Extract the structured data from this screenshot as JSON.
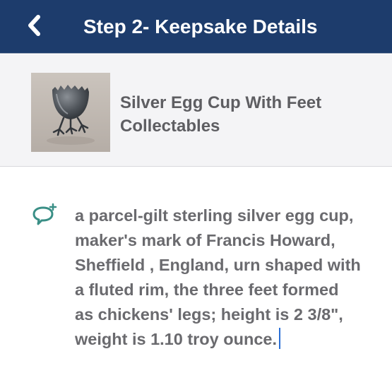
{
  "header": {
    "title": "Step 2- Keepsake Details",
    "back_icon": "chevron-left-icon"
  },
  "item": {
    "name": "Silver Egg Cup With Feet",
    "category": "Collectables"
  },
  "note": {
    "icon": "add-comment-icon",
    "lines": [
      "a parcel-gilt sterling silver egg cup,",
      "maker's mark of Francis Howard,",
      "Sheffield , England, urn shaped with",
      "a fluted rim, the three feet formed",
      "as chickens' legs; height is 2 3/8\",",
      "weight is 1.10 troy ounce."
    ]
  },
  "colors": {
    "header_bg": "#1d3c6c",
    "card_bg": "#f4f4f6",
    "text_gray": "#6a6a6e",
    "accent_teal": "#3a8f86",
    "caret_blue": "#2a6fd6"
  }
}
